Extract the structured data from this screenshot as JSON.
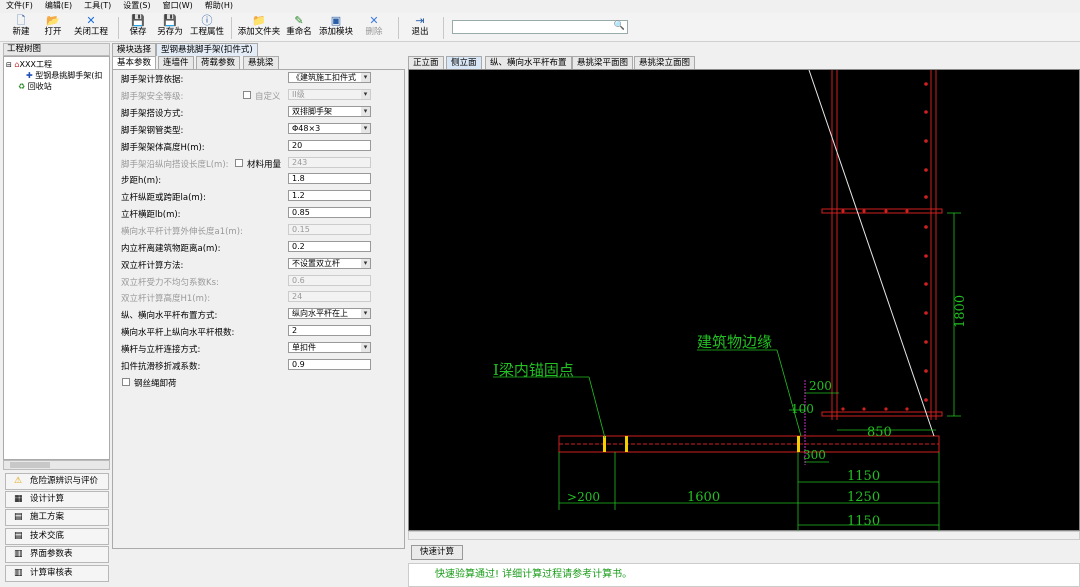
{
  "menu": [
    "文件(F)",
    "编辑(E)",
    "工具(T)",
    "设置(S)",
    "窗口(W)",
    "帮助(H)"
  ],
  "toolbar": {
    "new": "新建",
    "open": "打开",
    "close": "关闭工程",
    "save": "保存",
    "saveas": "另存为",
    "props": "工程属性",
    "addfolder": "添加文件夹",
    "rename": "重命名",
    "addmodule": "添加模块",
    "delete": "删除",
    "exit": "退出"
  },
  "tree": {
    "header": "工程树图",
    "items": [
      "XXX工程",
      "型钢悬挑脚手架(扣",
      "回收站"
    ]
  },
  "nav": [
    "危险源辨识与评价",
    "设计计算",
    "施工方案",
    "技术交底",
    "界面参数表",
    "计算审核表"
  ],
  "top_tabs": [
    "模块选择",
    "型钢悬挑脚手架(扣件式)"
  ],
  "param_tabs": [
    "基本参数",
    "连墙件",
    "荷载参数",
    "悬挑梁"
  ],
  "params": [
    {
      "label": "脚手架计算依据:",
      "value": "《建筑施工扣件式",
      "select": true,
      "disabled": false
    },
    {
      "label": "脚手架安全等级:",
      "value": "II级",
      "select": true,
      "disabled": true,
      "checkLabel": "自定义"
    },
    {
      "label": "脚手架搭设方式:",
      "value": "双排脚手架",
      "select": true,
      "disabled": false
    },
    {
      "label": "脚手架钢管类型:",
      "value": "Φ48×3",
      "select": true,
      "disabled": false
    },
    {
      "label": "脚手架架体高度H(m):",
      "value": "20",
      "select": false,
      "disabled": false
    },
    {
      "label": "脚手架沿纵向搭设长度L(m):",
      "value": "243",
      "select": false,
      "disabled": true,
      "checkLabel": "材料用量"
    },
    {
      "label": "步距h(m):",
      "value": "1.8",
      "select": false,
      "disabled": false
    },
    {
      "label": "立杆纵距或跨距la(m):",
      "value": "1.2",
      "select": false,
      "disabled": false
    },
    {
      "label": "立杆横距lb(m):",
      "value": "0.85",
      "select": false,
      "disabled": false
    },
    {
      "label": "横向水平杆计算外伸长度a1(m):",
      "value": "0.15",
      "select": false,
      "disabled": true
    },
    {
      "label": "内立杆离建筑物距离a(m):",
      "value": "0.2",
      "select": false,
      "disabled": false
    },
    {
      "label": "双立杆计算方法:",
      "value": "不设置双立杆",
      "select": true,
      "disabled": false
    },
    {
      "label": "双立杆受力不均匀系数Ks:",
      "value": "0.6",
      "select": false,
      "disabled": true
    },
    {
      "label": "双立杆计算高度H1(m):",
      "value": "24",
      "select": false,
      "disabled": true
    },
    {
      "label": "纵、横向水平杆布置方式:",
      "value": "纵向水平杆在上",
      "select": true,
      "disabled": false
    },
    {
      "label": "横向水平杆上纵向水平杆根数:",
      "value": "2",
      "select": false,
      "disabled": false
    },
    {
      "label": "横杆与立杆连接方式:",
      "value": "单扣件",
      "select": true,
      "disabled": false
    },
    {
      "label": "扣件抗滑移折减系数:",
      "value": "0.9",
      "select": false,
      "disabled": false
    }
  ],
  "rope_label": "钢丝绳卸荷",
  "view_tabs": [
    "正立面",
    "侧立面",
    "纵、横向水平杆布置",
    "悬挑梁平面图",
    "悬挑梁立面图"
  ],
  "drawing": {
    "label_anchor": "I梁内锚固点",
    "label_edge": "建筑物边缘",
    "dims": [
      "1800",
      "200",
      "100",
      "850",
      "300",
      "1150",
      "1250",
      "1600",
      "200",
      "1150"
    ]
  },
  "quick_calc": "快速计算",
  "status_text": "快速验算通过! 详细计算过程请参考计算书。"
}
